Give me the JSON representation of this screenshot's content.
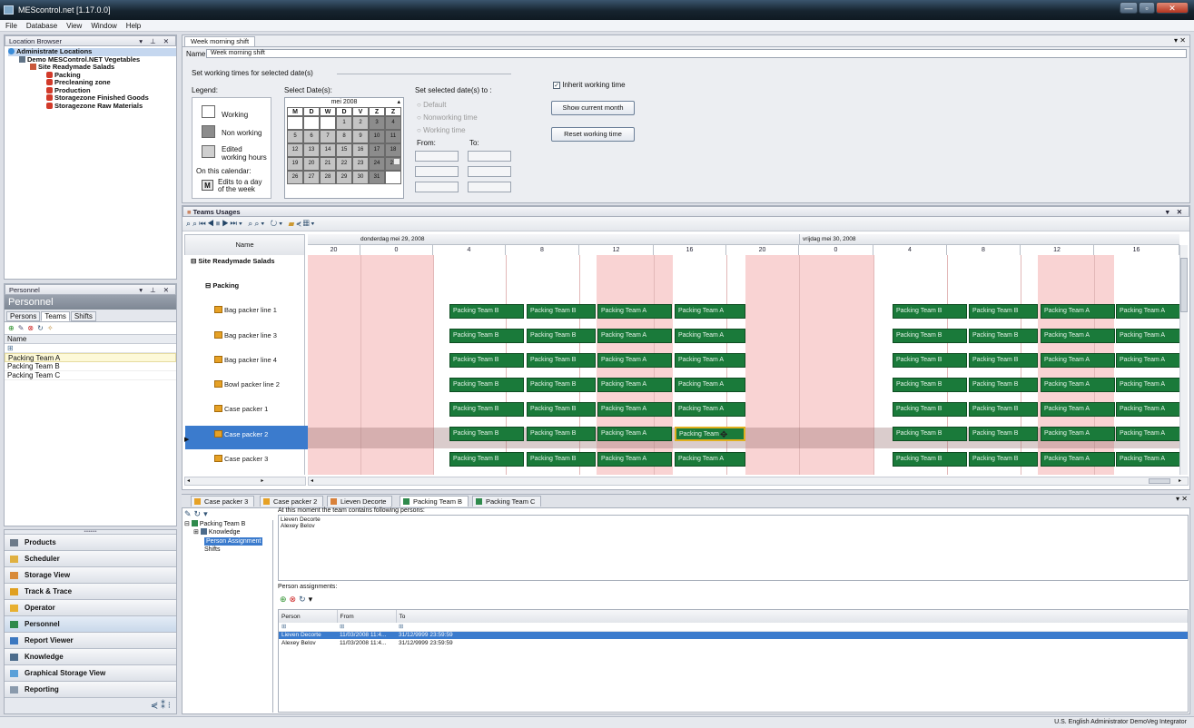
{
  "window": {
    "title": "MEScontrol.net [1.17.0.0]",
    "buttons": {
      "minimize": "—",
      "restore": "▫",
      "close": "✕"
    }
  },
  "menu": [
    "File",
    "Database",
    "View",
    "Window",
    "Help"
  ],
  "location_browser": {
    "header": "Location Browser",
    "tree": [
      {
        "label": "Administrate Locations",
        "icon": "globe-icon"
      },
      {
        "label": "Demo MESControl.NET Vegetables",
        "icon": "building-icon"
      },
      {
        "label": "Site Readymade Salads",
        "icon": "site-icon"
      },
      {
        "label": "Packing",
        "icon": "zone-icon"
      },
      {
        "label": "Precleaning zone",
        "icon": "zone-icon"
      },
      {
        "label": "Production",
        "icon": "zone-icon"
      },
      {
        "label": "Storagezone Finished Goods",
        "icon": "zone-icon"
      },
      {
        "label": "Storagezone Raw Materials",
        "icon": "zone-icon"
      }
    ]
  },
  "personnel": {
    "header": "Personnel",
    "title": "Personnel",
    "tabs": [
      "Persons",
      "Teams",
      "Shifts"
    ],
    "column": "Name",
    "rows": [
      "Packing Team A",
      "Packing Team B",
      "Packing Team C"
    ]
  },
  "nav": [
    {
      "label": "Products",
      "icon": "products-icon"
    },
    {
      "label": "Scheduler",
      "icon": "scheduler-icon"
    },
    {
      "label": "Storage View",
      "icon": "storage-icon"
    },
    {
      "label": "Track & Trace",
      "icon": "trace-icon"
    },
    {
      "label": "Operator",
      "icon": "operator-icon"
    },
    {
      "label": "Personnel",
      "icon": "personnel-icon"
    },
    {
      "label": "Report Viewer",
      "icon": "report-icon"
    },
    {
      "label": "Knowledge",
      "icon": "knowledge-icon"
    },
    {
      "label": "Graphical Storage View",
      "icon": "graph-storage-icon"
    },
    {
      "label": "Reporting",
      "icon": "reporting-icon"
    }
  ],
  "shift_doc": {
    "tab": "Week morning shift",
    "name_label": "Name:",
    "name_value": "Week morning shift",
    "group_label": "Set working times for selected date(s)",
    "legend_label": "Legend:",
    "legend": [
      "Working",
      "Non working",
      "Edited working hours"
    ],
    "on_calendar": "On this calendar:",
    "day_marker": "M",
    "day_note": "Edits to a day of the week",
    "select_dates": "Select Date(s):",
    "month": "mei 2008",
    "weekdays": [
      "M",
      "D",
      "W",
      "D",
      "V",
      "Z",
      "Z"
    ],
    "cal_rows": [
      [
        "",
        "",
        "",
        "1",
        "2",
        "3",
        "4"
      ],
      [
        "5",
        "6",
        "7",
        "8",
        "9",
        "10",
        "11"
      ],
      [
        "12",
        "13",
        "14",
        "15",
        "16",
        "17",
        "18"
      ],
      [
        "19",
        "20",
        "21",
        "22",
        "23",
        "24",
        "25"
      ],
      [
        "26",
        "27",
        "28",
        "29",
        "30",
        "31",
        ""
      ]
    ],
    "set_to": "Set selected date(s) to :",
    "options": [
      "Default",
      "Nonworking time",
      "Working time"
    ],
    "from": "From:",
    "to": "To:",
    "inherit": "Inherit working time",
    "btn_show": "Show current month",
    "btn_reset": "Reset working time"
  },
  "teams_usages": {
    "tab": "Teams Usages",
    "name_col": "Name",
    "day1": "donderdag mei 29, 2008",
    "day2": "vrijdag mei 30, 2008",
    "hours": [
      "20",
      "0",
      "4",
      "8",
      "12",
      "16",
      "20",
      "0",
      "4",
      "8",
      "12",
      "16"
    ],
    "groups": [
      "Site Readymade Salads",
      "Packing"
    ],
    "rows": [
      "Bag packer line 1",
      "Bag packer line 3",
      "Bag packer line 4",
      "Bowl packer line 2",
      "Case packer 1",
      "Case packer 2",
      "Case packer 3"
    ],
    "bars": [
      "Packing Team B",
      "Packing Team B",
      "Packing Team A",
      "Packing Team A",
      "Packing Team B",
      "Packing Team B",
      "Packing Team A",
      "Packing Team A"
    ],
    "edited_bar": "Packing Team"
  },
  "bottom": {
    "tabs": [
      "Case packer 3",
      "Case packer 2",
      "Lieven Decorte",
      "Packing Team B",
      "Packing Team C"
    ],
    "tree": {
      "root": "Packing Team B",
      "items": [
        "Knowledge",
        "Person Assignment",
        "Shifts"
      ]
    },
    "info": "At this moment the team contains following persons:",
    "persons": [
      "Lieven Decorte",
      "Alexey Belov"
    ],
    "assign_label": "Person assignments:",
    "columns": [
      "Person",
      "From",
      "To"
    ],
    "rows": [
      [
        "Lieven Decorte",
        "11/03/2008 11:4...",
        "31/12/9999 23:59:59"
      ],
      [
        "Alexey Belov",
        "11/03/2008 11:4...",
        "31/12/9999 23:59:59"
      ]
    ]
  },
  "status": "U.S. English  Administrator  DemoVeg Integrator",
  "colors": {
    "nonworking": "#f9d3d3",
    "bar": "#1a7a3a",
    "selection": "#3b7bcd"
  }
}
